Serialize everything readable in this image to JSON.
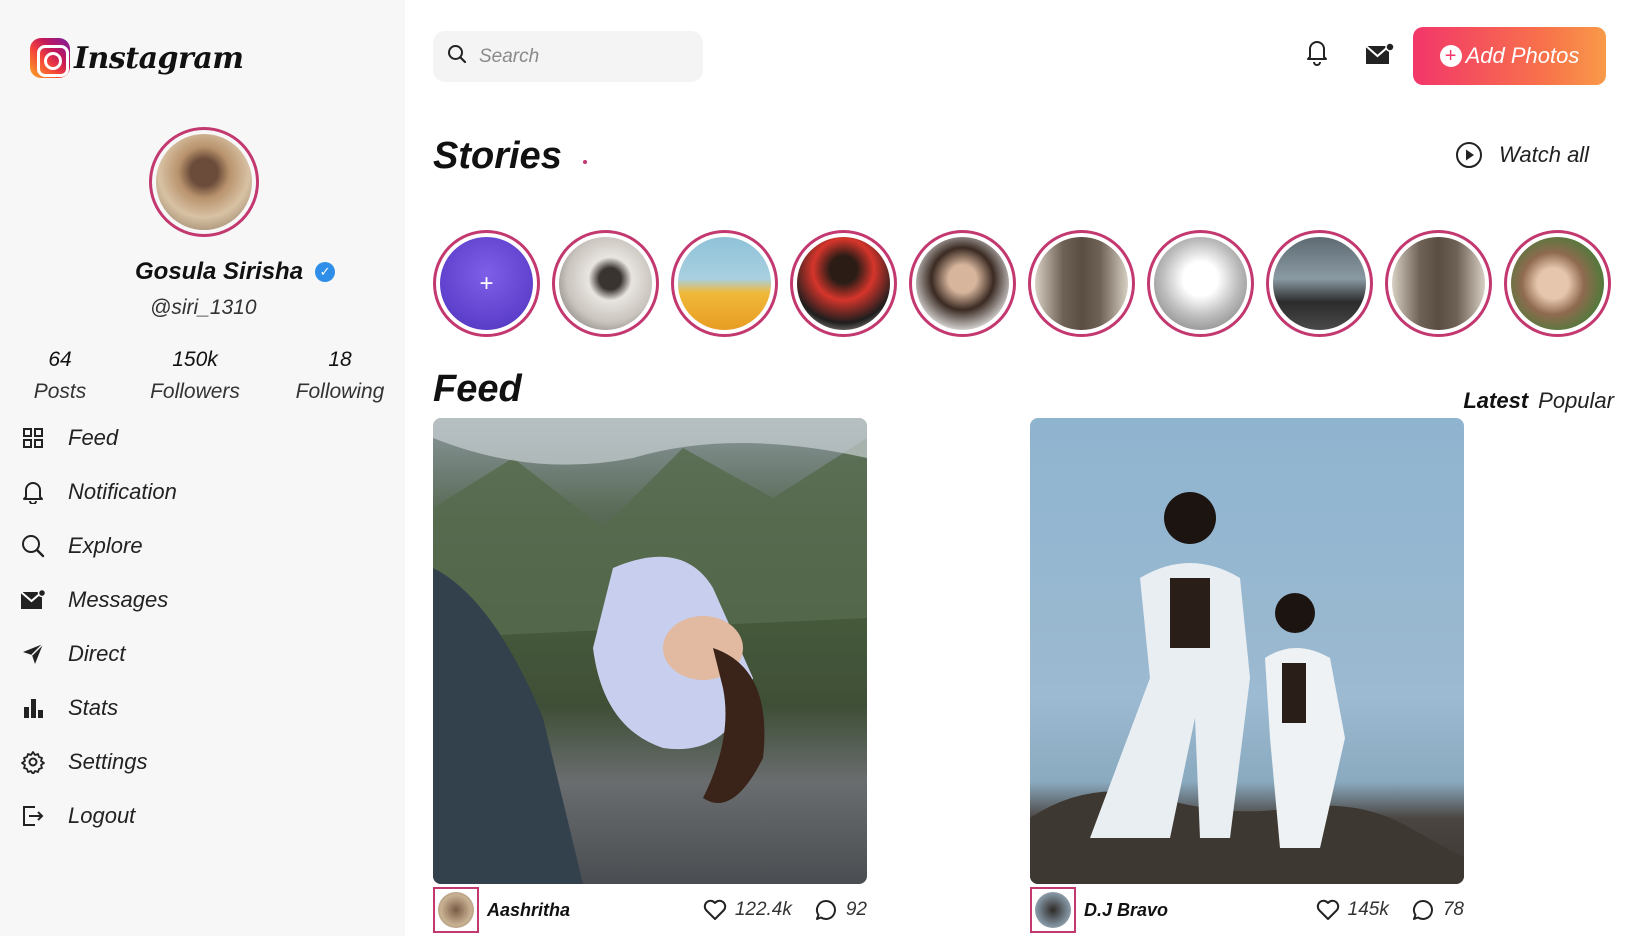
{
  "app": {
    "name": "Instagram"
  },
  "profile": {
    "name": "Gosula Sirisha",
    "verified_icon": "check",
    "handle": "@siri_1310",
    "stats": [
      {
        "value": "64",
        "label": "Posts"
      },
      {
        "value": "150k",
        "label": "Followers"
      },
      {
        "value": "18",
        "label": "Following"
      }
    ]
  },
  "sidebar": {
    "items": [
      {
        "label": "Feed",
        "icon": "grid-icon"
      },
      {
        "label": "Notification",
        "icon": "bell-icon"
      },
      {
        "label": "Explore",
        "icon": "search-icon"
      },
      {
        "label": "Messages",
        "icon": "mail-icon"
      },
      {
        "label": "Direct",
        "icon": "send-icon"
      },
      {
        "label": "Stats",
        "icon": "bar-chart-icon"
      },
      {
        "label": "Settings",
        "icon": "gear-icon"
      },
      {
        "label": "Logout",
        "icon": "logout-icon"
      }
    ]
  },
  "header": {
    "search_placeholder": "Search",
    "add_photos_label": "Add Photos",
    "add_photos_plus": "+"
  },
  "stories": {
    "title": "Stories",
    "watch_all": "Watch all",
    "add_symbol": "+",
    "count": 10
  },
  "feed": {
    "title": "Feed",
    "tabs": {
      "latest": "Latest",
      "popular": "Popular"
    },
    "posts": [
      {
        "author": "Aashritha",
        "likes": "122.4k",
        "comments": "92"
      },
      {
        "author": "D.J Bravo",
        "likes": "145k",
        "comments": "78"
      }
    ]
  },
  "colors": {
    "accent": "#c2386f",
    "button_gradient_start": "#f2366a",
    "button_gradient_end": "#f99a49",
    "verified": "#2f8fe8",
    "sidebar_bg": "#f7f7f7"
  }
}
